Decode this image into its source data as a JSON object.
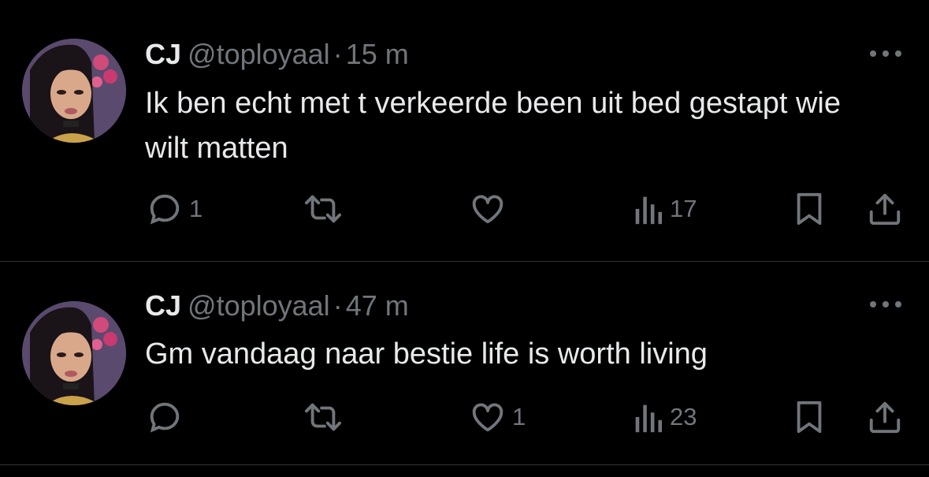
{
  "colors": {
    "background": "#000000",
    "text_primary": "#e7e9ea",
    "text_secondary": "#71767b",
    "divider": "#2f3336"
  },
  "tweets": [
    {
      "name": "CJ",
      "handle": "@toployaal",
      "separator": "·",
      "time": "15 m",
      "text": "Ik ben echt met t verkeerde been uit bed gestapt wie wilt matten",
      "reply_count": "1",
      "retweet_count": "",
      "like_count": "",
      "view_count": "17",
      "icons": [
        "comment-icon",
        "retweet-icon",
        "heart-icon",
        "views-icon",
        "bookmark-icon",
        "share-icon",
        "more-icon"
      ]
    },
    {
      "name": "CJ",
      "handle": "@toployaal",
      "separator": "·",
      "time": "47 m",
      "text": "Gm vandaag naar bestie life is worth living",
      "reply_count": "",
      "retweet_count": "",
      "like_count": "1",
      "view_count": "23",
      "icons": [
        "comment-icon",
        "retweet-icon",
        "heart-icon",
        "views-icon",
        "bookmark-icon",
        "share-icon",
        "more-icon"
      ]
    }
  ]
}
